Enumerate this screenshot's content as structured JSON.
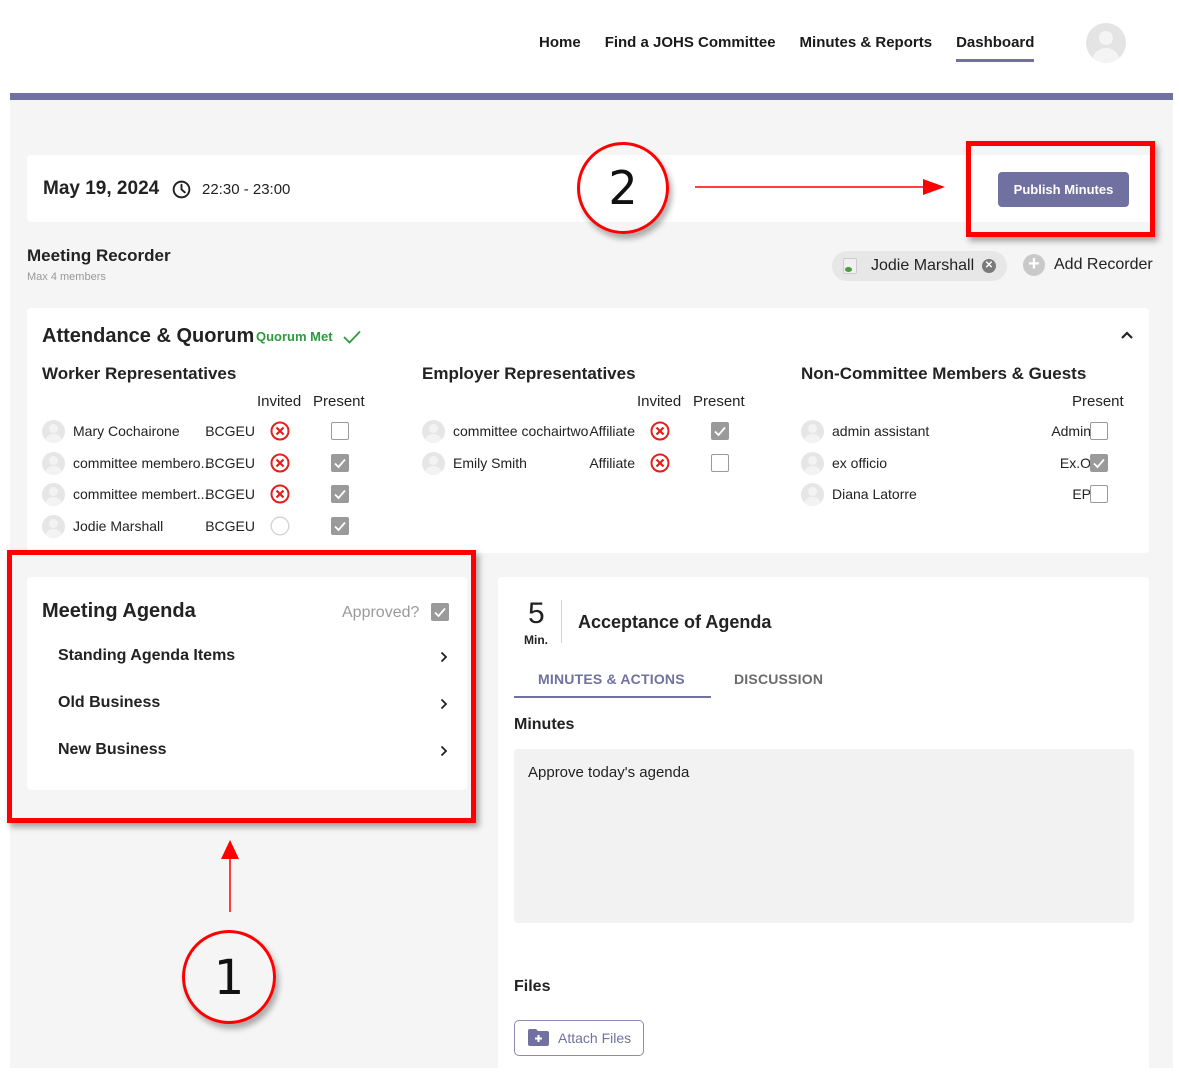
{
  "nav": {
    "links": [
      {
        "label": "Home",
        "active": false
      },
      {
        "label": "Find a JOHS Committee",
        "active": false
      },
      {
        "label": "Minutes & Reports",
        "active": false
      },
      {
        "label": "Dashboard",
        "active": true
      }
    ],
    "avatar_icon": "user-avatar-icon"
  },
  "meeting": {
    "date": "May 19, 2024",
    "time_icon": "clock-icon",
    "time": "22:30 - 23:00",
    "publish_label": "Publish Minutes"
  },
  "recorder": {
    "title": "Meeting Recorder",
    "subtitle": "Max 4 members",
    "chips": [
      {
        "name": "Jodie Marshall"
      }
    ],
    "add_label": "Add Recorder"
  },
  "attendance": {
    "title": "Attendance & Quorum",
    "quorum_status": "Quorum Met",
    "groups": [
      {
        "title": "Worker Representatives",
        "col_invited": "Invited",
        "col_present": "Present",
        "members": [
          {
            "name": "Mary Cochairone",
            "org": "BCGEU",
            "invited": "declined",
            "present": false
          },
          {
            "name": "committee membero...",
            "org": "BCGEU",
            "invited": "declined",
            "present": true
          },
          {
            "name": "committee membert...",
            "org": "BCGEU",
            "invited": "declined",
            "present": true
          },
          {
            "name": "Jodie Marshall",
            "org": "BCGEU",
            "invited": "none",
            "present": true
          }
        ]
      },
      {
        "title": "Employer Representatives",
        "col_invited": "Invited",
        "col_present": "Present",
        "members": [
          {
            "name": "committee cochairtwo",
            "org": "Affiliate",
            "invited": "declined",
            "present": true
          },
          {
            "name": "Emily Smith",
            "org": "Affiliate",
            "invited": "declined",
            "present": false
          }
        ]
      },
      {
        "title": "Non-Committee Members & Guests",
        "col_present": "Present",
        "members": [
          {
            "name": "admin assistant",
            "org": "Admin",
            "present": false
          },
          {
            "name": "ex officio",
            "org": "Ex.O",
            "present": true
          },
          {
            "name": "Diana Latorre",
            "org": "EP",
            "present": false
          }
        ]
      }
    ]
  },
  "agenda": {
    "title": "Meeting Agenda",
    "approved_label": "Approved?",
    "approved": true,
    "items": [
      {
        "label": "Standing Agenda Items"
      },
      {
        "label": "Old Business"
      },
      {
        "label": "New Business"
      }
    ]
  },
  "item": {
    "duration": "5",
    "duration_unit": "Min.",
    "title": "Acceptance of Agenda",
    "tabs": [
      {
        "label": "MINUTES & ACTIONS",
        "active": true
      },
      {
        "label": "DISCUSSION",
        "active": false
      }
    ],
    "minutes_label": "Minutes",
    "minutes_text": "Approve today's agenda",
    "files_label": "Files",
    "attach_label": "Attach Files"
  },
  "annotations": {
    "callout_1": "1",
    "callout_2": "2",
    "color": "#ff0000"
  },
  "colors": {
    "accent": "#7071a0",
    "success": "#2e9a3e",
    "declined": "#e0201e",
    "background": "#f5f5f5"
  }
}
